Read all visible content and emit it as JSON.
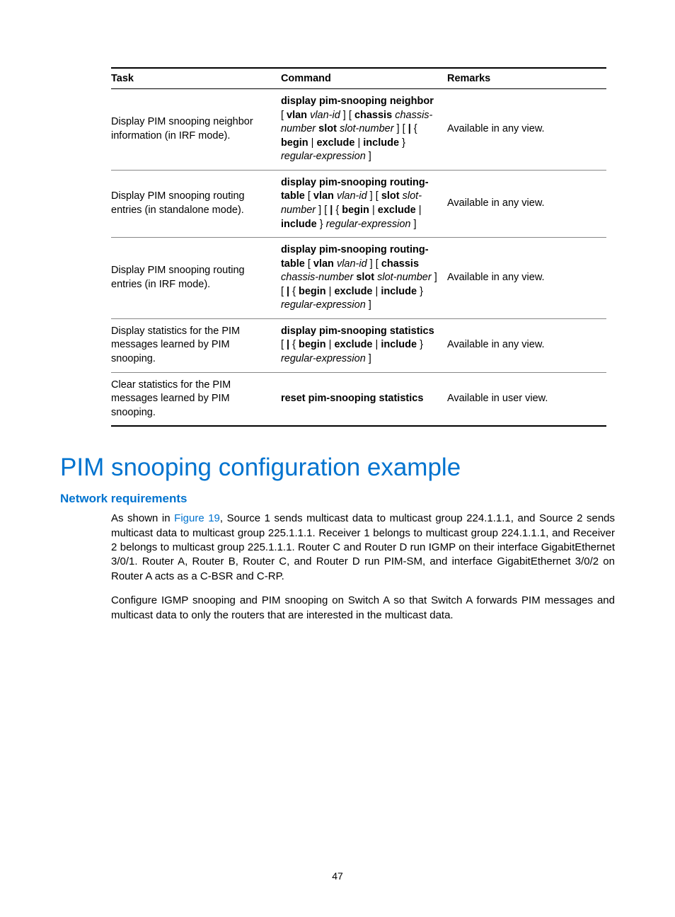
{
  "table": {
    "headers": [
      "Task",
      "Command",
      "Remarks"
    ],
    "rows": [
      {
        "task": "Display PIM snooping neighbor information (in IRF mode).",
        "cmd": [
          {
            "t": "display pim-snooping neighbor",
            "c": "b"
          },
          {
            "t": " [ ",
            "c": ""
          },
          {
            "t": "vlan",
            "c": "b"
          },
          {
            "t": " ",
            "c": ""
          },
          {
            "t": "vlan-id",
            "c": "i"
          },
          {
            "t": " ] [ ",
            "c": ""
          },
          {
            "t": "chassis",
            "c": "b"
          },
          {
            "t": " ",
            "c": ""
          },
          {
            "t": "chassis-number",
            "c": "i"
          },
          {
            "t": " ",
            "c": ""
          },
          {
            "t": "slot",
            "c": "b"
          },
          {
            "t": " ",
            "c": ""
          },
          {
            "t": "slot-number",
            "c": "i"
          },
          {
            "t": " ] [ ",
            "c": ""
          },
          {
            "t": "|",
            "c": "b"
          },
          {
            "t": " { ",
            "c": ""
          },
          {
            "t": "begin",
            "c": "b"
          },
          {
            "t": " | ",
            "c": ""
          },
          {
            "t": "exclude",
            "c": "b"
          },
          {
            "t": " | ",
            "c": ""
          },
          {
            "t": "include",
            "c": "b"
          },
          {
            "t": " } ",
            "c": ""
          },
          {
            "t": "regular-expression",
            "c": "i"
          },
          {
            "t": " ]",
            "c": ""
          }
        ],
        "remarks": "Available in any view."
      },
      {
        "task": "Display PIM snooping routing entries (in standalone mode).",
        "cmd": [
          {
            "t": "display pim-snooping routing-table",
            "c": "b"
          },
          {
            "t": " [ ",
            "c": ""
          },
          {
            "t": "vlan",
            "c": "b"
          },
          {
            "t": " ",
            "c": ""
          },
          {
            "t": "vlan-id",
            "c": "i"
          },
          {
            "t": " ] [ ",
            "c": ""
          },
          {
            "t": "slot",
            "c": "b"
          },
          {
            "t": " ",
            "c": ""
          },
          {
            "t": "slot-number",
            "c": "i"
          },
          {
            "t": " ] [ ",
            "c": ""
          },
          {
            "t": "|",
            "c": "b"
          },
          {
            "t": " { ",
            "c": ""
          },
          {
            "t": "begin",
            "c": "b"
          },
          {
            "t": " | ",
            "c": ""
          },
          {
            "t": "exclude",
            "c": "b"
          },
          {
            "t": " | ",
            "c": ""
          },
          {
            "t": "include",
            "c": "b"
          },
          {
            "t": " } ",
            "c": ""
          },
          {
            "t": "regular-expression",
            "c": "i"
          },
          {
            "t": " ]",
            "c": ""
          }
        ],
        "remarks": "Available in any view."
      },
      {
        "task": "Display PIM snooping routing entries (in IRF mode).",
        "cmd": [
          {
            "t": "display pim-snooping routing-table",
            "c": "b"
          },
          {
            "t": " [ ",
            "c": ""
          },
          {
            "t": "vlan",
            "c": "b"
          },
          {
            "t": " ",
            "c": ""
          },
          {
            "t": "vlan-id",
            "c": "i"
          },
          {
            "t": " ] [ ",
            "c": ""
          },
          {
            "t": "chassis",
            "c": "b"
          },
          {
            "t": " ",
            "c": ""
          },
          {
            "t": "chassis-number",
            "c": "i"
          },
          {
            "t": " ",
            "c": ""
          },
          {
            "t": "slot",
            "c": "b"
          },
          {
            "t": " ",
            "c": ""
          },
          {
            "t": "slot-number",
            "c": "i"
          },
          {
            "t": " ] [ ",
            "c": ""
          },
          {
            "t": "|",
            "c": "b"
          },
          {
            "t": " { ",
            "c": ""
          },
          {
            "t": "begin",
            "c": "b"
          },
          {
            "t": " | ",
            "c": ""
          },
          {
            "t": "exclude",
            "c": "b"
          },
          {
            "t": " | ",
            "c": ""
          },
          {
            "t": "include",
            "c": "b"
          },
          {
            "t": " } ",
            "c": ""
          },
          {
            "t": "regular-expression",
            "c": "i"
          },
          {
            "t": " ]",
            "c": ""
          }
        ],
        "remarks": "Available in any view."
      },
      {
        "task": "Display statistics for the PIM messages learned by PIM snooping.",
        "cmd": [
          {
            "t": "display pim-snooping statistics",
            "c": "b"
          },
          {
            "t": " [ ",
            "c": ""
          },
          {
            "t": "|",
            "c": "b"
          },
          {
            "t": " { ",
            "c": ""
          },
          {
            "t": "begin",
            "c": "b"
          },
          {
            "t": " | ",
            "c": ""
          },
          {
            "t": "exclude",
            "c": "b"
          },
          {
            "t": " | ",
            "c": ""
          },
          {
            "t": "include",
            "c": "b"
          },
          {
            "t": " } ",
            "c": ""
          },
          {
            "t": "regular-expression",
            "c": "i"
          },
          {
            "t": " ]",
            "c": ""
          }
        ],
        "remarks": "Available in any view."
      },
      {
        "task": "Clear statistics for the PIM messages learned by PIM snooping.",
        "cmd": [
          {
            "t": "reset pim-snooping statistics",
            "c": "b"
          }
        ],
        "remarks": "Available in user view."
      }
    ]
  },
  "heading1": "PIM snooping configuration example",
  "heading2": "Network requirements",
  "para1_pre": "As shown in ",
  "para1_link": "Figure 19",
  "para1_post": ", Source 1 sends multicast data to multicast group 224.1.1.1, and Source 2 sends multicast data to multicast group 225.1.1.1. Receiver 1 belongs to multicast group 224.1.1.1, and Receiver 2 belongs to multicast group 225.1.1.1. Router C and Router D run IGMP on their interface GigabitEthernet 3/0/1. Router A, Router B, Router C, and Router D run PIM-SM, and interface GigabitEthernet 3/0/2 on Router A acts as a C-BSR and C-RP.",
  "para2": "Configure IGMP snooping and PIM snooping on Switch A so that Switch A forwards PIM messages and multicast data to only the routers that are interested in the multicast data.",
  "page_number": "47"
}
